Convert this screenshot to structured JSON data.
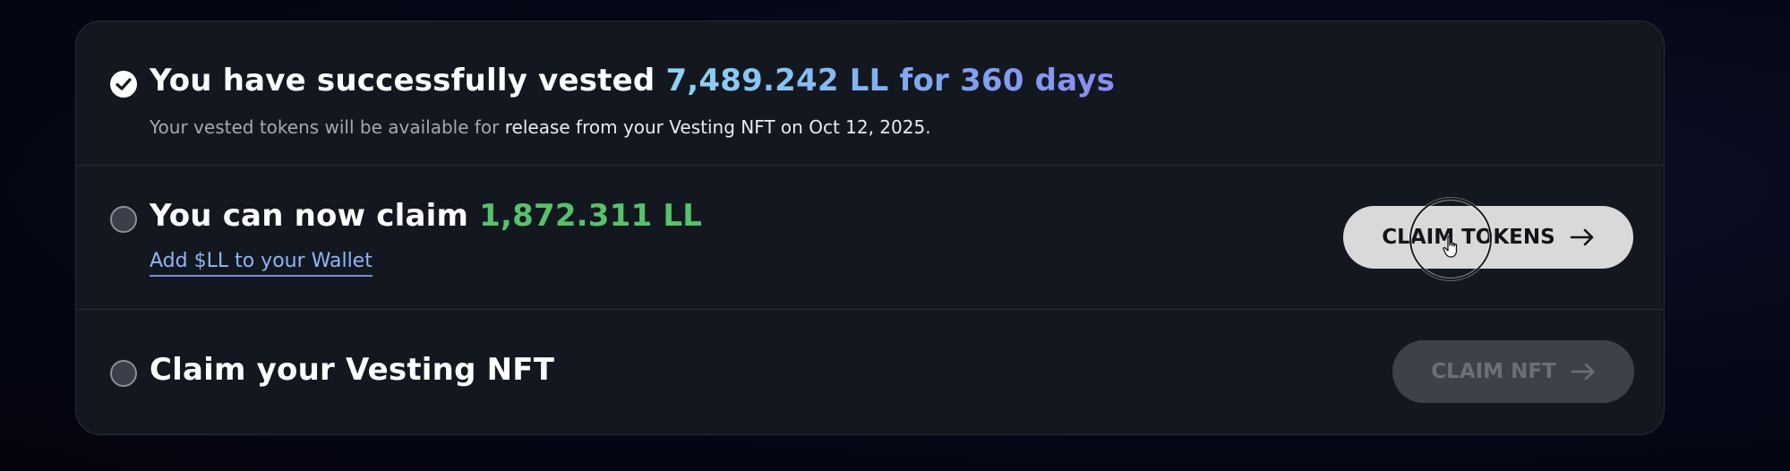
{
  "steps": {
    "vested": {
      "title_prefix": "You have successfully vested ",
      "title_highlight": "7,489.242 LL for 360 days",
      "sub_prefix": "Your vested tokens will be available for ",
      "sub_highlight": "release from your Vesting NFT on Oct 12, 2025.",
      "status": "check-circle-icon"
    },
    "claim_tokens": {
      "title_prefix": "You can now claim ",
      "title_highlight": "1,872.311 LL",
      "link": "Add $LL to your Wallet",
      "button_label": "CLAIM TOKENS",
      "status": "empty-circle-icon"
    },
    "claim_nft": {
      "title": "Claim your Vesting NFT",
      "button_label": "CLAIM NFT",
      "status": "empty-circle-icon"
    }
  },
  "colors": {
    "highlight_gradient_start": "#8fd6f2",
    "highlight_gradient_end": "#8a8cf2",
    "claim_amount": "#57c26a",
    "link": "#8fb6f2",
    "card_bg": "#131820"
  },
  "icons": {
    "arrow": "arrow-right-icon",
    "cursor": "hand-pointer-icon"
  }
}
